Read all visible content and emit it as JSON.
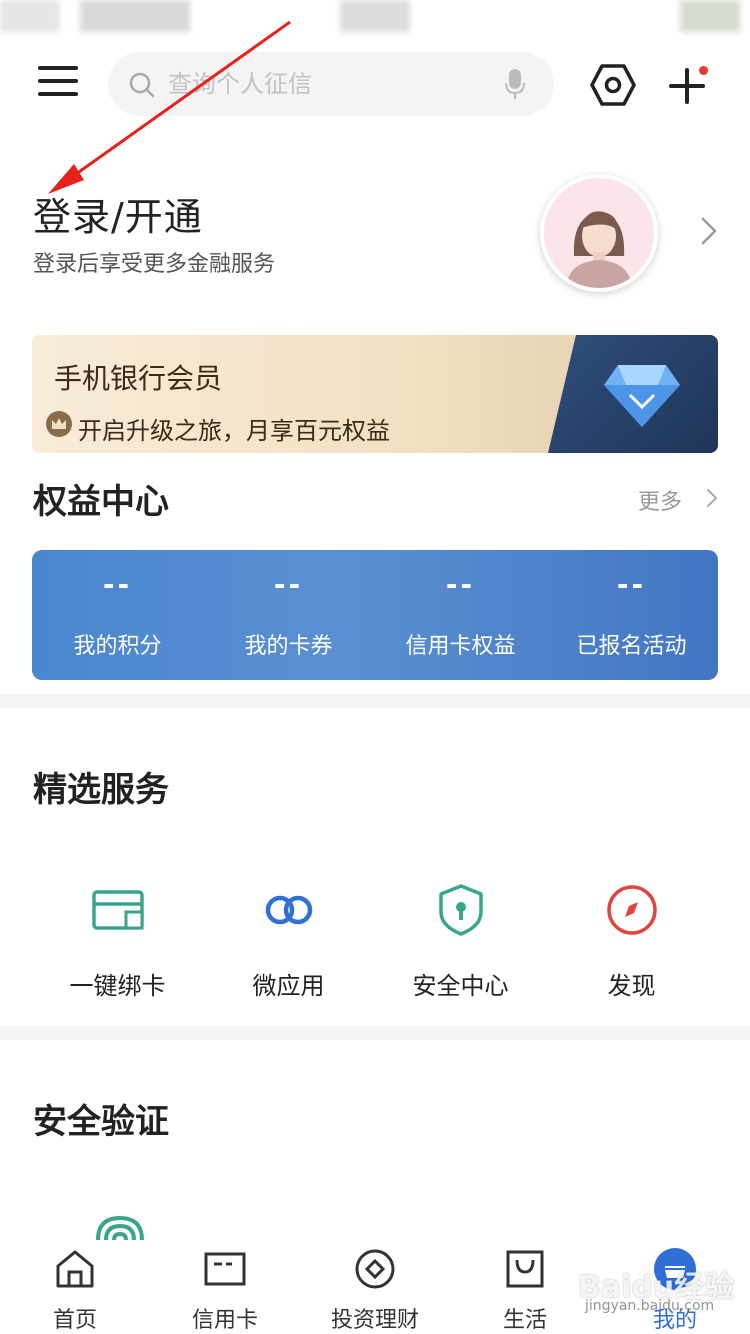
{
  "header": {
    "search_placeholder": "查询个人征信"
  },
  "login": {
    "title": "登录/开通",
    "subtitle": "登录后享受更多金融服务"
  },
  "member_banner": {
    "title": "手机银行会员",
    "subtitle": "开启升级之旅，月享百元权益"
  },
  "rights_center": {
    "title": "权益中心",
    "more": "更多",
    "items": [
      {
        "value": "--",
        "label": "我的积分"
      },
      {
        "value": "--",
        "label": "我的卡券"
      },
      {
        "value": "--",
        "label": "信用卡权益"
      },
      {
        "value": "--",
        "label": "已报名活动"
      }
    ]
  },
  "services": {
    "title": "精选服务",
    "items": [
      {
        "label": "一键绑卡",
        "icon": "bind-card-icon",
        "color": "#3aa58c"
      },
      {
        "label": "微应用",
        "icon": "link-icon",
        "color": "#2f6fd6"
      },
      {
        "label": "安全中心",
        "icon": "shield-icon",
        "color": "#3aa58c"
      },
      {
        "label": "发现",
        "icon": "compass-icon",
        "color": "#e0463c"
      }
    ]
  },
  "security": {
    "title": "安全验证"
  },
  "tabbar": {
    "items": [
      {
        "label": "首页",
        "icon": "home-icon"
      },
      {
        "label": "信用卡",
        "icon": "credit-card-icon"
      },
      {
        "label": "投资理财",
        "icon": "invest-icon"
      },
      {
        "label": "生活",
        "icon": "shopping-bag-icon"
      },
      {
        "label": "我的",
        "icon": "profile-icon",
        "active": true
      }
    ],
    "active_color": "#2f6fd6"
  },
  "watermark": {
    "brand": "Baidu经验",
    "url": "jingyan.baidu.com"
  }
}
